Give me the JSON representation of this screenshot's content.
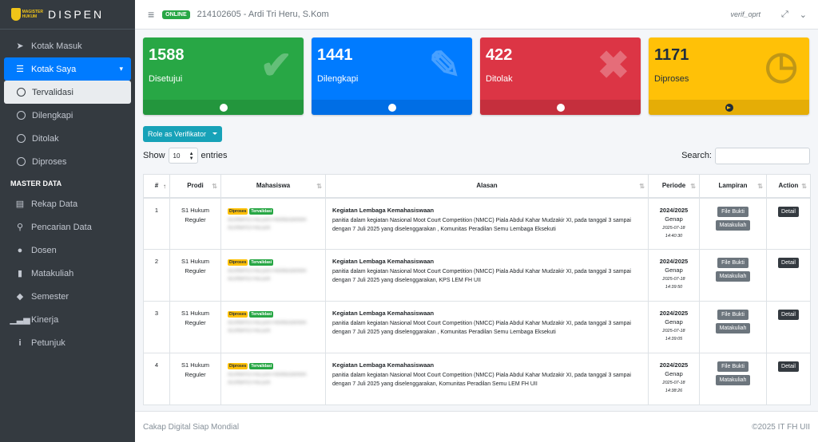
{
  "brand": {
    "name": "DISPEN",
    "logo_text_line1": "MAGISTER",
    "logo_text_line2": "HUKUM"
  },
  "sidebar": {
    "items": [
      {
        "label": "Kotak Masuk",
        "icon": "paper-plane-icon"
      },
      {
        "label": "Kotak Saya",
        "icon": "list-icon"
      }
    ],
    "subitems": [
      {
        "label": "Tervalidasi"
      },
      {
        "label": "Dilengkapi"
      },
      {
        "label": "Ditolak"
      },
      {
        "label": "Diproses"
      }
    ],
    "header": "MASTER DATA",
    "master": [
      {
        "label": "Rekap Data",
        "icon": "printer-icon"
      },
      {
        "label": "Pencarian Data",
        "icon": "search-icon"
      },
      {
        "label": "Dosen",
        "icon": "user-icon"
      },
      {
        "label": "Matakuliah",
        "icon": "book-icon"
      },
      {
        "label": "Semester",
        "icon": "tag-icon"
      },
      {
        "label": "Kinerja",
        "icon": "signal-icon"
      },
      {
        "label": "Petunjuk",
        "icon": "info-icon"
      }
    ]
  },
  "topbar": {
    "status": "ONLINE",
    "user": "214102605 - Ardi Tri Heru, S.Kom",
    "username": "verif_oprt"
  },
  "stats": [
    {
      "value": "1588",
      "label": "Disetujui",
      "color": "#28a745",
      "icon": "check-icon"
    },
    {
      "value": "1441",
      "label": "Dilengkapi",
      "color": "#007bff",
      "icon": "edit-icon"
    },
    {
      "value": "422",
      "label": "Ditolak",
      "color": "#dc3545",
      "icon": "times-icon"
    },
    {
      "value": "1171",
      "label": "Diproses",
      "color": "#ffc107",
      "icon": "clock-icon"
    }
  ],
  "role_button": "Role as Verifikator",
  "table_controls": {
    "show": "Show",
    "entries_value": "10",
    "entries": "entries",
    "search": "Search:"
  },
  "table": {
    "headers": [
      "#",
      "Prodi",
      "Mahasiswa",
      "Alasan",
      "Periode",
      "Lampiran",
      "Action"
    ],
    "rows": [
      {
        "no": "1",
        "prodi1": "S1 Hukum",
        "prodi2": "Reguler",
        "badge1": "Diproses",
        "badge2": "Tervalidasi",
        "mhs1": "ALVINAYO FALLEN FRIANUGRAHA",
        "mhs2": "ALVINAYO FALLEN",
        "title": "Kegiatan Lembaga Kemahasiswaan",
        "desc": "panitia dalam kegiatan Nasional Moot Court Competition (NMCC) Piala Abdul Kahar Mudzakir XI, pada tanggal 3 sampai dengan 7 Juli 2025 yang diselenggarakan , Komunitas Peradilan Semu Lembaga Eksekuti",
        "periode": "2024/2025",
        "sem": "Genap",
        "date": "2025-07-18",
        "time": "14:40:30",
        "btn1": "File Bukti",
        "btn2": "Matakuliah",
        "action": "Detail"
      },
      {
        "no": "2",
        "prodi1": "S1 Hukum",
        "prodi2": "Reguler",
        "badge1": "Diproses",
        "badge2": "Tervalidasi",
        "mhs1": "ALVINAYO FALLEN FRIANUGRAHA",
        "mhs2": "ALVINAYO FALLEN",
        "title": "Kegiatan Lembaga Kemahasiswaan",
        "desc": "panitia dalam kegiatan Nasional Moot Court Competition (NMCC) Piala Abdul Kahar Mudzakir XI, pada tanggal 3 sampai dengan 7 Juli 2025 yang diselenggarakan, KPS LEM FH UII",
        "periode": "2024/2025",
        "sem": "Genap",
        "date": "2025-07-18",
        "time": "14:39:50",
        "btn1": "File Bukti",
        "btn2": "Matakuliah",
        "action": "Detail"
      },
      {
        "no": "3",
        "prodi1": "S1 Hukum",
        "prodi2": "Reguler",
        "badge1": "Diproses",
        "badge2": "Tervalidasi",
        "mhs1": "ALVINAYO FALLEN FRIANUGRAHA",
        "mhs2": "ALVINAYO FALLEN",
        "title": "Kegiatan Lembaga Kemahasiswaan",
        "desc": "panitia dalam kegiatan Nasional Moot Court Competition (NMCC) Piala Abdul Kahar Mudzakir XI, pada tanggal 3 sampai dengan 7 Juli 2025 yang diselenggarakan , Komunitas Peradilan Semu Lembaga Eksekuti",
        "periode": "2024/2025",
        "sem": "Genap",
        "date": "2025-07-18",
        "time": "14:39:05",
        "btn1": "File Bukti",
        "btn2": "Matakuliah",
        "action": "Detail"
      },
      {
        "no": "4",
        "prodi1": "S1 Hukum",
        "prodi2": "Reguler",
        "badge1": "Diproses",
        "badge2": "Tervalidasi",
        "mhs1": "ALVINAYO FALLEN FRIANUGRAHA",
        "mhs2": "ALVINAYO FALLEN",
        "title": "Kegiatan Lembaga Kemahasiswaan",
        "desc": "panitia dalam kegiatan Nasional Moot Court Competition (NMCC) Piala Abdul Kahar Mudzakir XI, pada tanggal 3 sampai dengan 7 Juli 2025 yang diselenggarakan, Komunitas Peradilan Semu LEM FH UII",
        "periode": "2024/2025",
        "sem": "Genap",
        "date": "2025-07-18",
        "time": "14:38:26",
        "btn1": "File Bukti",
        "btn2": "Matakuliah",
        "action": "Detail"
      }
    ]
  },
  "footer": {
    "left": "Cakap Digital Siap Mondial",
    "right": "©2025 IT FH UII"
  }
}
